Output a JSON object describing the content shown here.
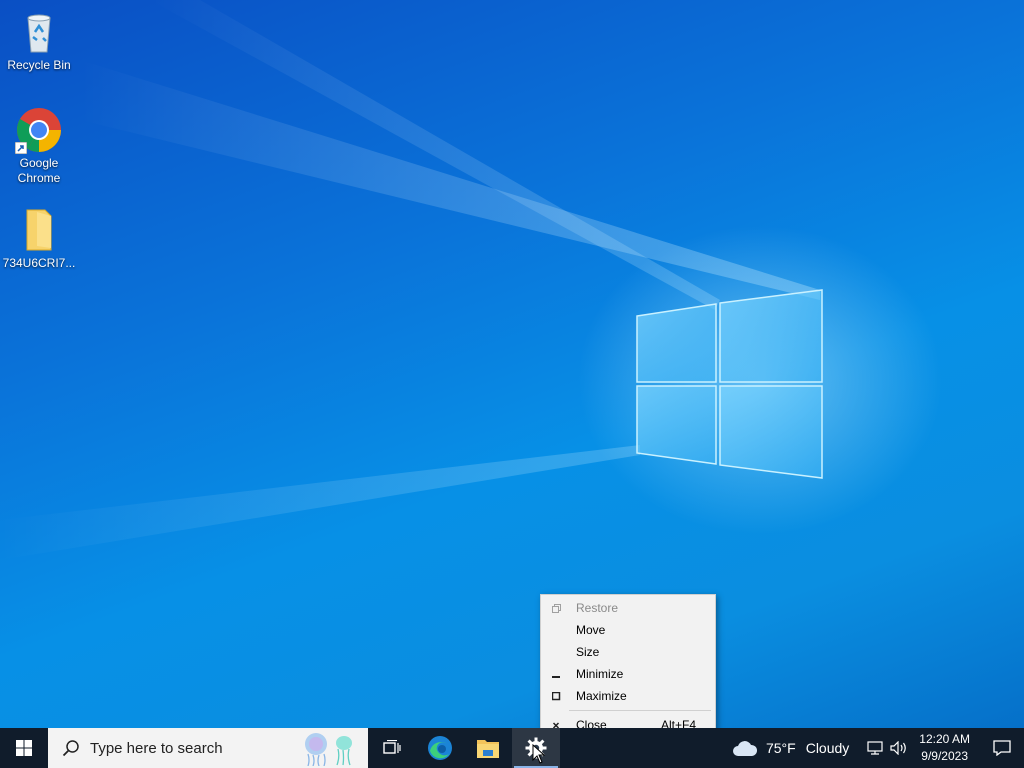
{
  "desktop": {
    "icons": [
      {
        "label": "Recycle Bin",
        "icon": "recycle-bin-icon"
      },
      {
        "label": "Google Chrome",
        "icon": "chrome-icon"
      },
      {
        "label": "734U6CRI7...",
        "icon": "folder-icon"
      }
    ]
  },
  "taskbar": {
    "search_placeholder": "Type here to search",
    "apps": [
      {
        "name": "Task View",
        "icon": "task-view-icon"
      },
      {
        "name": "Microsoft Edge",
        "icon": "edge-icon"
      },
      {
        "name": "File Explorer",
        "icon": "file-explorer-icon"
      },
      {
        "name": "Settings",
        "icon": "gear-icon",
        "active": true
      }
    ],
    "weather": {
      "temp": "75°F",
      "condition": "Cloudy",
      "icon": "cloud-icon"
    },
    "clock": {
      "time": "12:20 AM",
      "date": "9/9/2023"
    }
  },
  "context_menu": {
    "items": [
      {
        "label": "Restore",
        "disabled": true,
        "icon": "restore-icon"
      },
      {
        "label": "Move"
      },
      {
        "label": "Size"
      },
      {
        "label": "Minimize",
        "icon": "minimize-icon"
      },
      {
        "label": "Maximize",
        "icon": "maximize-icon"
      },
      {
        "label": "Close",
        "accelerator": "Alt+F4",
        "icon": "close-icon"
      }
    ]
  },
  "colors": {
    "taskbar": "#101c2b",
    "desktop": "#0a73d9",
    "menu": "#f2f2f2"
  }
}
